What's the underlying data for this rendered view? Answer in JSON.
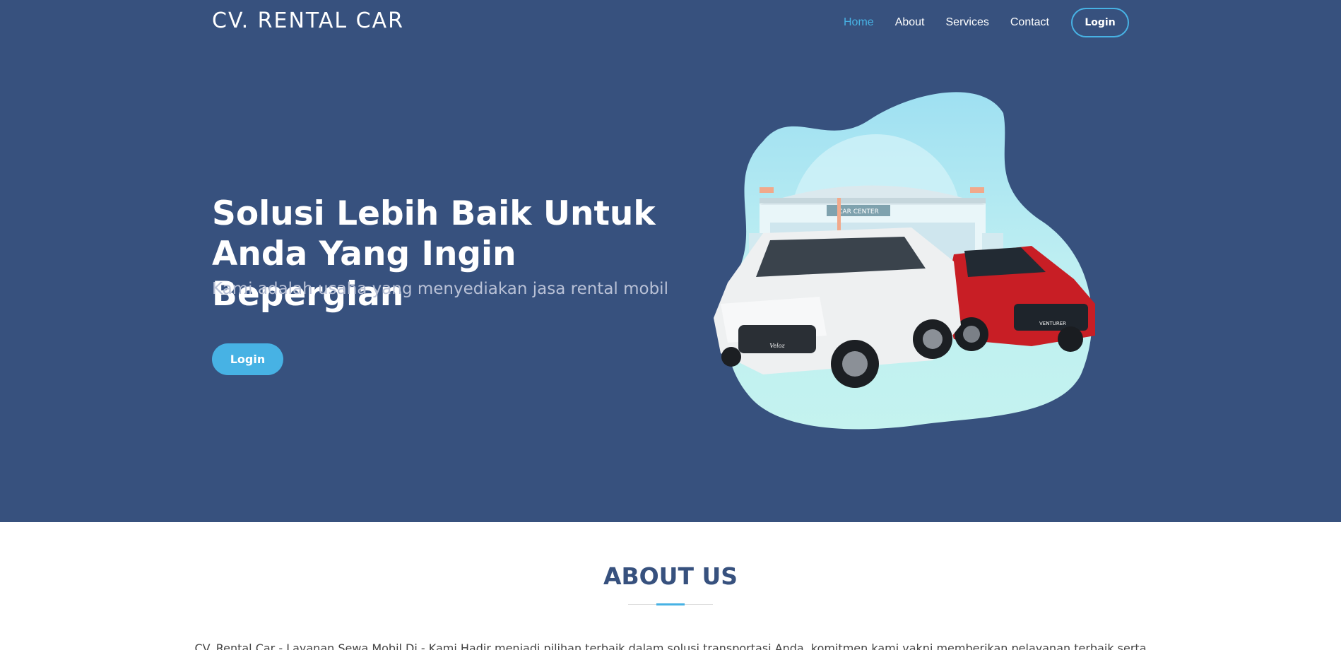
{
  "header": {
    "brand": "CV. RENTAL CAR",
    "nav": [
      {
        "label": "Home",
        "active": true
      },
      {
        "label": "About"
      },
      {
        "label": "Services"
      },
      {
        "label": "Contact"
      }
    ],
    "login_label": "Login"
  },
  "hero": {
    "title": "Solusi Lebih Baik Untuk Anda Yang Ingin Bepergian",
    "subtitle": "Kami adalah usaha yang menyediakan jasa rental mobil",
    "button_label": "Login",
    "illustration_sign": "CAR CENTER",
    "car_badges": [
      "Veloz",
      "VENTURER"
    ]
  },
  "about": {
    "title": "ABOUT US",
    "text": "CV. Rental Car - Layanan Sewa Mobil Di - Kami Hadir menjadi pilihan terbaik dalam solusi transportasi Anda, komitmen kami yakni memberikan pelayanan terbaik serta"
  },
  "colors": {
    "primary": "#37517e",
    "accent": "#47b2e4",
    "white": "#ffffff"
  }
}
